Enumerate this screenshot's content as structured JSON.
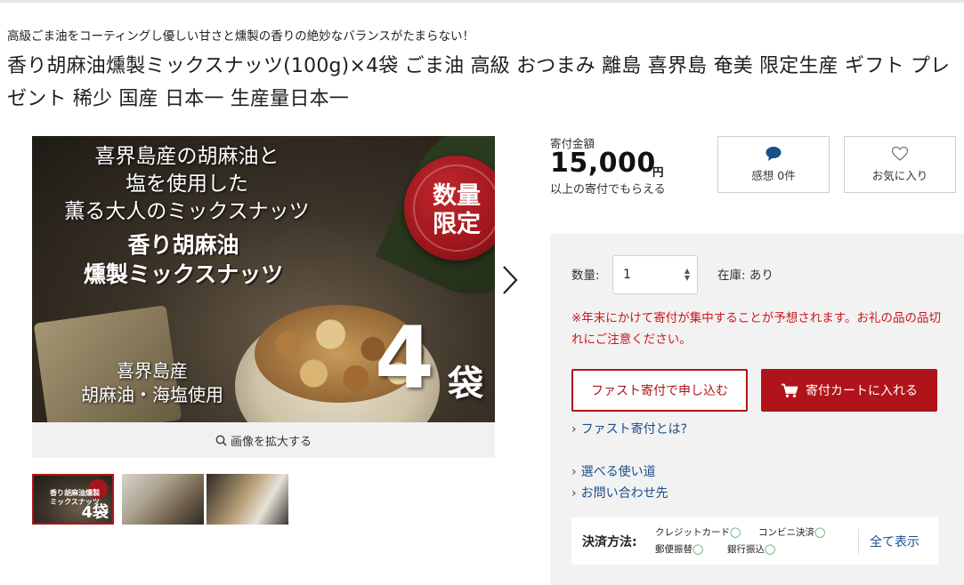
{
  "product": {
    "catch_copy": "高級ごま油をコーティングし優しい甘さと燻製の香りの絶妙なバランスがたまらない！",
    "title": "香り胡麻油燻製ミックスナッツ(100g)×4袋 ごま油 高級 おつまみ 離島 喜界島 奄美 限定生産 ギフト プレゼント 稀少 国産 日本一 生産量日本一"
  },
  "main_image": {
    "copy_line1": "喜界島産の胡麻油と",
    "copy_line2": "塩を使用した",
    "copy_line3": "薫る大人のミックスナッツ",
    "product_name_line1": "香り胡麻油",
    "product_name_line2": "燻製ミックスナッツ",
    "origin_line1": "喜界島産",
    "origin_line2": "胡麻油・海塩使用",
    "seal_line1": "数量",
    "seal_line2": "限定",
    "count": "4",
    "count_unit": "袋"
  },
  "gallery": {
    "zoom_label": "画像を拡大する",
    "thumb1_text": "香り胡麻油燻製ミックスナッツ",
    "thumb1_count": "4袋",
    "thumb_count": 3
  },
  "donation": {
    "label": "寄付金額",
    "amount": "15,000",
    "unit": "円",
    "note": "以上の寄付でもらえる"
  },
  "actions": {
    "review_label": "感想 0件",
    "favorite_label": "お気に入り"
  },
  "order": {
    "qty_label": "数量:",
    "qty_value": "1",
    "stock_label": "在庫: あり",
    "notice": "※年末にかけて寄付が集中することが予想されます。お礼の品の品切れにご注意ください。",
    "fast_button": "ファスト寄付で申し込む",
    "cart_button": "寄付カートに入れる"
  },
  "links": {
    "fast_about": "ファスト寄付とは?",
    "usage": "選べる使い道",
    "contact": "お問い合わせ先"
  },
  "payment": {
    "label": "決済方法:",
    "methods": [
      "クレジットカード",
      "コンビニ決済",
      "郵便振替",
      "銀行振込"
    ],
    "check_mark": "◯",
    "show_all": "全て表示"
  },
  "colors": {
    "accent_red": "#b0141a",
    "notice_red": "#c8171e",
    "link_blue": "#1a4f88",
    "ok_green": "#3aa04a"
  }
}
